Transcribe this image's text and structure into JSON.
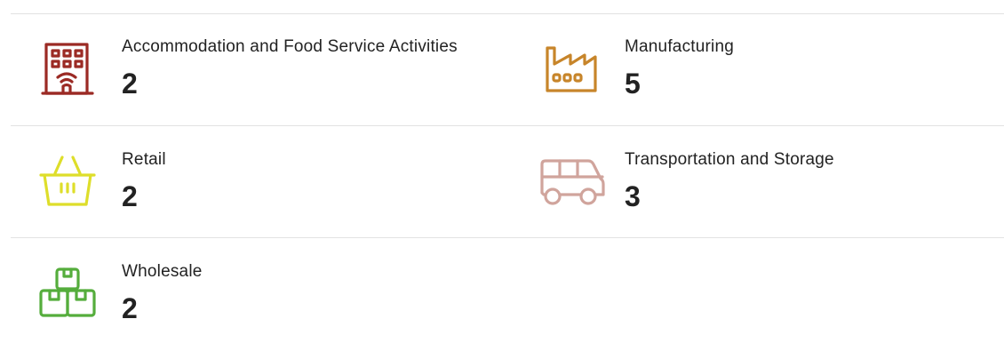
{
  "industries": [
    {
      "label": "Accommodation and Food Service Activities",
      "count": "2",
      "icon": "hotel-building-icon",
      "color": "#9b2a24"
    },
    {
      "label": "Manufacturing",
      "count": "5",
      "icon": "factory-icon",
      "color": "#c7852a"
    },
    {
      "label": "Retail",
      "count": "2",
      "icon": "shopping-basket-icon",
      "color": "#dede2a"
    },
    {
      "label": "Transportation and Storage",
      "count": "3",
      "icon": "van-icon",
      "color": "#d0a49c"
    },
    {
      "label": "Wholesale",
      "count": "2",
      "icon": "boxes-icon",
      "color": "#55ad3c"
    }
  ]
}
